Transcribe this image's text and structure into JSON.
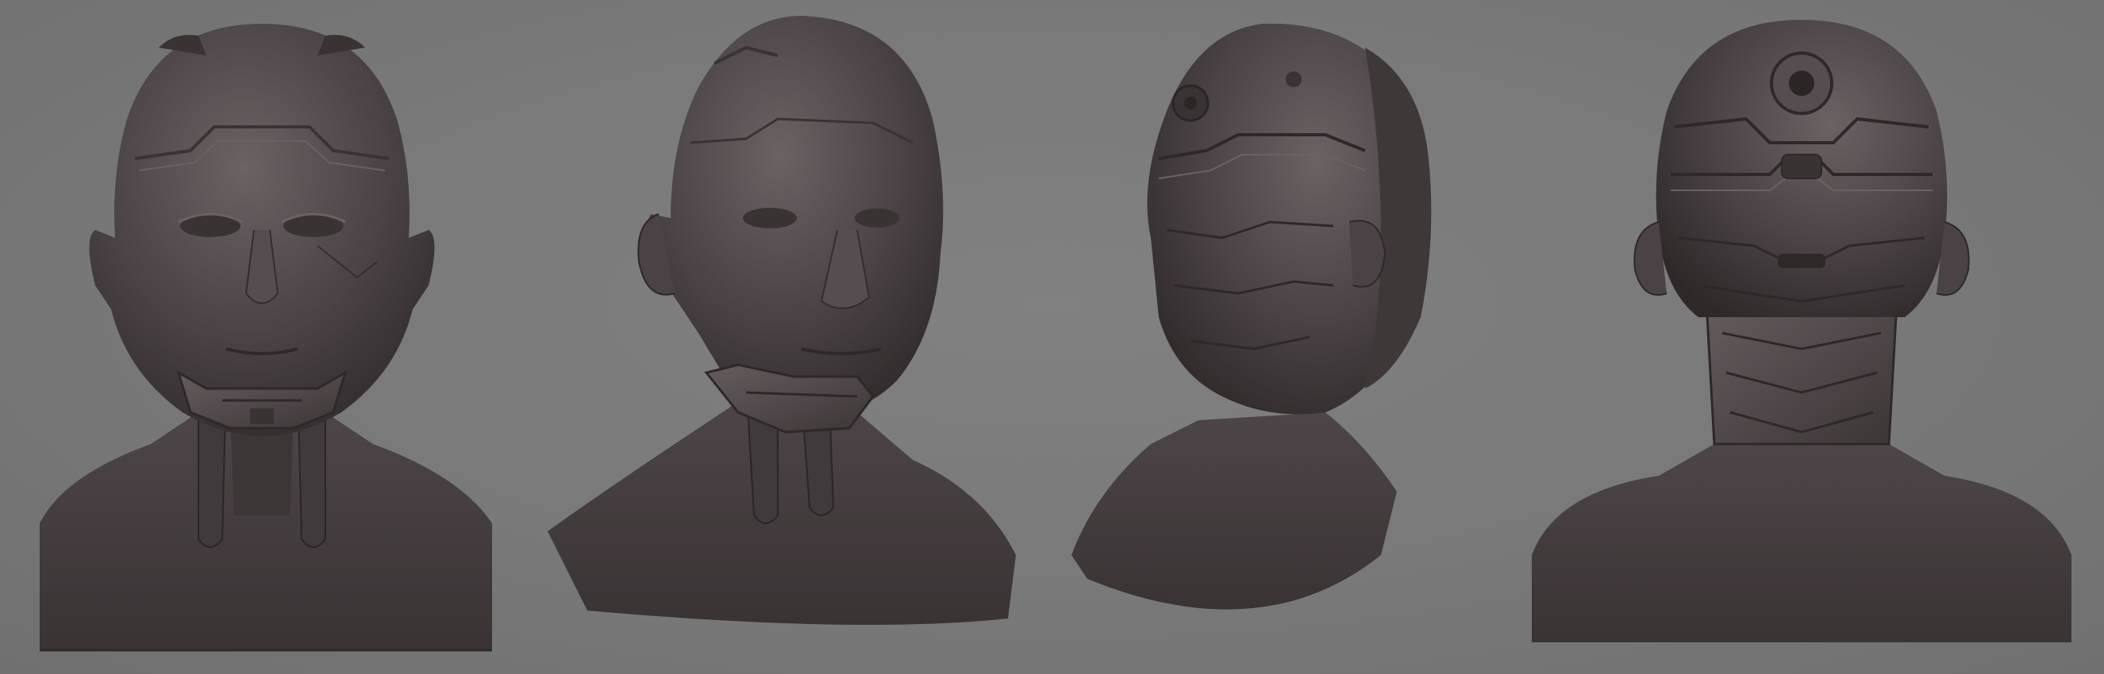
{
  "scene": {
    "background_color": "#7b7b7b",
    "sculpt_color": "#4a4244",
    "sculpt_highlight": "#6b6264",
    "sculpt_shadow": "#2e2829"
  },
  "views": [
    {
      "view": "front",
      "icon": "cyborg-head-front"
    },
    {
      "view": "three-quarter-left",
      "icon": "cyborg-head-three-quarter"
    },
    {
      "view": "back-three-quarter",
      "icon": "cyborg-head-back-three-quarter"
    },
    {
      "view": "back",
      "icon": "cyborg-head-back"
    }
  ]
}
